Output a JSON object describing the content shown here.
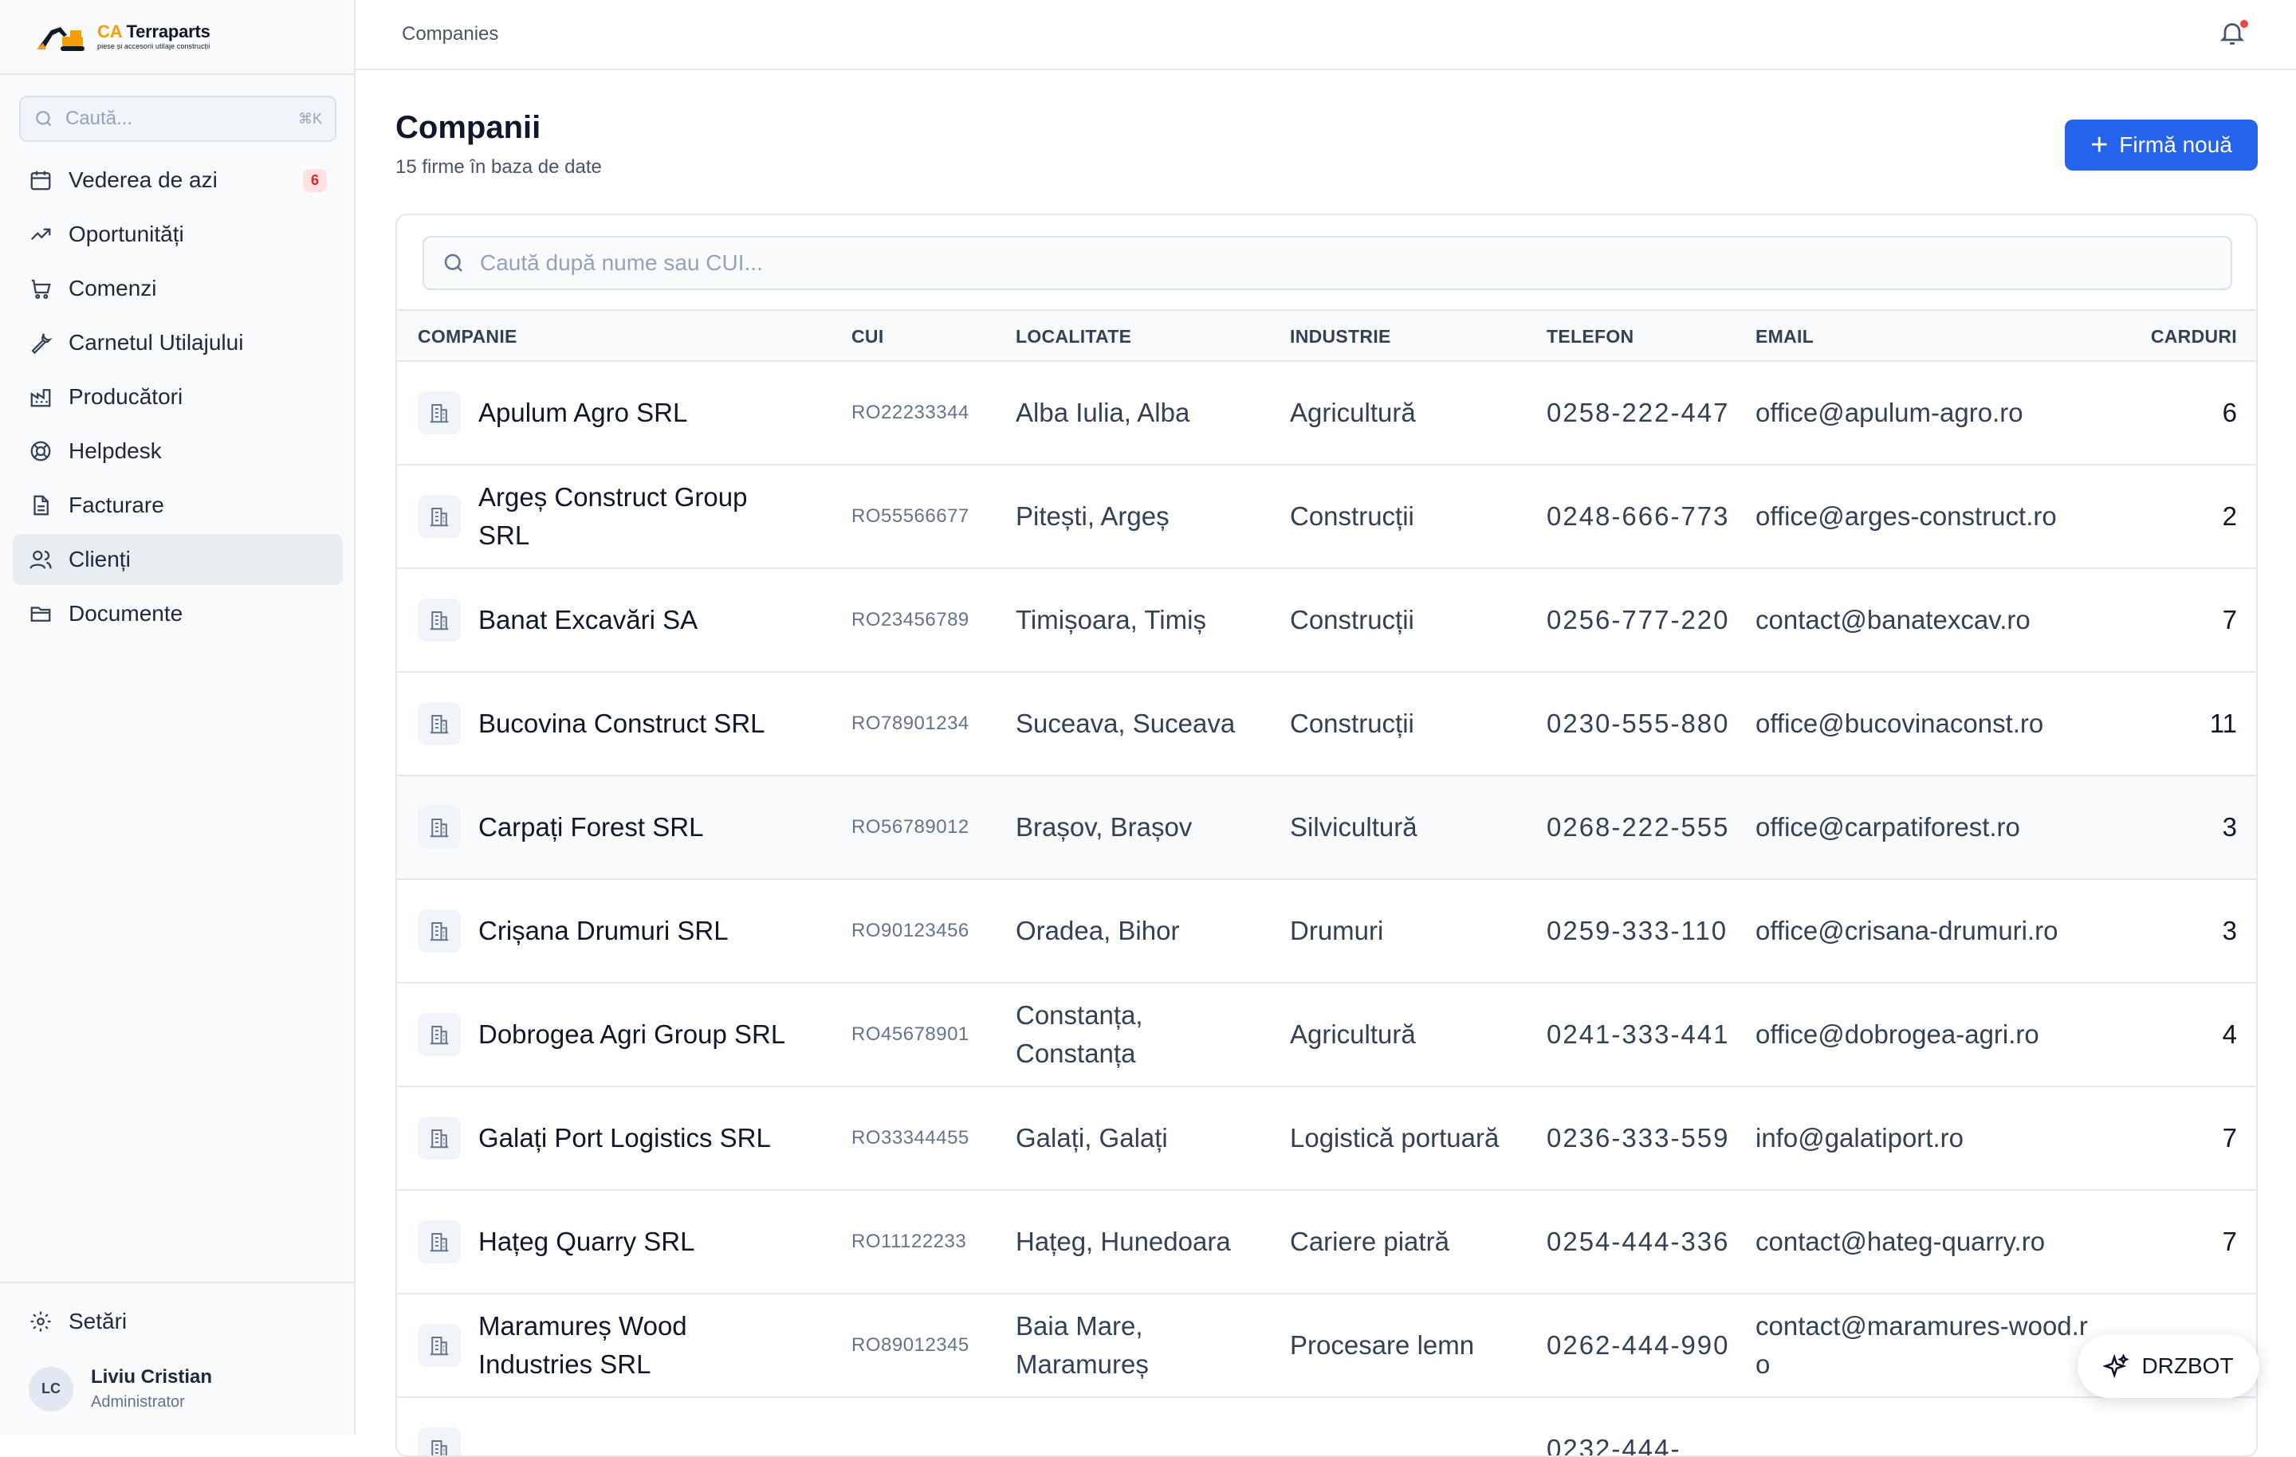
{
  "brand": {
    "name_prefix": "CA",
    "name": "Terraparts",
    "tagline": "piese și accesorii utilaje construcții"
  },
  "sidebar": {
    "search_placeholder": "Caută...",
    "search_shortcut": "⌘K",
    "items": [
      {
        "label": "Vederea de azi",
        "icon": "calendar-icon",
        "badge": "6"
      },
      {
        "label": "Oportunități",
        "icon": "trending-up-icon"
      },
      {
        "label": "Comenzi",
        "icon": "cart-icon"
      },
      {
        "label": "Carnetul Utilajului",
        "icon": "wrench-icon"
      },
      {
        "label": "Producători",
        "icon": "factory-icon"
      },
      {
        "label": "Helpdesk",
        "icon": "lifebuoy-icon"
      },
      {
        "label": "Facturare",
        "icon": "file-text-icon"
      },
      {
        "label": "Clienți",
        "icon": "users-icon",
        "active": true
      },
      {
        "label": "Documente",
        "icon": "folder-icon"
      }
    ],
    "settings_label": "Setări",
    "user": {
      "initials": "LC",
      "name": "Liviu Cristian",
      "role": "Administrator"
    }
  },
  "topbar": {
    "breadcrumb": "Companies"
  },
  "page": {
    "title": "Companii",
    "subtitle": "15 firme în baza de date",
    "new_button": "Firmă nouă",
    "search_placeholder": "Caută după nume sau CUI..."
  },
  "table": {
    "columns": [
      "COMPANIE",
      "CUI",
      "LOCALITATE",
      "INDUSTRIE",
      "TELEFON",
      "EMAIL",
      "CARDURI"
    ],
    "rows": [
      {
        "company": "Apulum Agro SRL",
        "cui": "RO22233344",
        "locality": "Alba Iulia, Alba",
        "industry": "Agricultură",
        "phone": "0258-222-447",
        "email": "office@apulum-agro.ro",
        "cards": "6"
      },
      {
        "company": "Argeș Construct Group SRL",
        "cui": "RO55566677",
        "locality": "Pitești, Argeș",
        "industry": "Construcții",
        "phone": "0248-666-773",
        "email": "office@arges-construct.ro",
        "cards": "2"
      },
      {
        "company": "Banat Excavări SA",
        "cui": "RO23456789",
        "locality": "Timișoara, Timiș",
        "industry": "Construcții",
        "phone": "0256-777-220",
        "email": "contact@banatexcav.ro",
        "cards": "7"
      },
      {
        "company": "Bucovina Construct SRL",
        "cui": "RO78901234",
        "locality": "Suceava, Suceava",
        "industry": "Construcții",
        "phone": "0230-555-880",
        "email": "office@bucovinaconst.ro",
        "cards": "11"
      },
      {
        "company": "Carpați Forest SRL",
        "cui": "RO56789012",
        "locality": "Brașov, Brașov",
        "industry": "Silvicultură",
        "phone": "0268-222-555",
        "email": "office@carpatiforest.ro",
        "cards": "3",
        "highlight": true
      },
      {
        "company": "Crișana Drumuri SRL",
        "cui": "RO90123456",
        "locality": "Oradea, Bihor",
        "industry": "Drumuri",
        "phone": "0259-333-110",
        "email": "office@crisana-drumuri.ro",
        "cards": "3"
      },
      {
        "company": "Dobrogea Agri Group SRL",
        "cui": "RO45678901",
        "locality": "Constanța, Constanța",
        "industry": "Agricultură",
        "phone": "0241-333-441",
        "email": "office@dobrogea-agri.ro",
        "cards": "4"
      },
      {
        "company": "Galați Port Logistics SRL",
        "cui": "RO33344455",
        "locality": "Galați, Galați",
        "industry": "Logistică portuară",
        "phone": "0236-333-559",
        "email": "info@galatiport.ro",
        "cards": "7"
      },
      {
        "company": "Hațeg Quarry SRL",
        "cui": "RO11122233",
        "locality": "Hațeg, Hunedoara",
        "industry": "Cariere piatră",
        "phone": "0254-444-336",
        "email": "contact@hateg-quarry.ro",
        "cards": "7"
      },
      {
        "company": "Maramureș Wood Industries SRL",
        "cui": "RO89012345",
        "locality": "Baia Mare, Maramureș",
        "industry": "Procesare lemn",
        "phone": "0262-444-990",
        "email": "contact@maramures-wood.ro",
        "cards": ""
      },
      {
        "company": "",
        "cui": "",
        "locality": "",
        "industry": "",
        "phone": "0232-444-",
        "email": "",
        "cards": ""
      }
    ]
  },
  "bot": {
    "label": "DRZBOT"
  },
  "colors": {
    "accent": "#2563eb",
    "badge": "#dc2626",
    "logo": "#f59e0b"
  }
}
